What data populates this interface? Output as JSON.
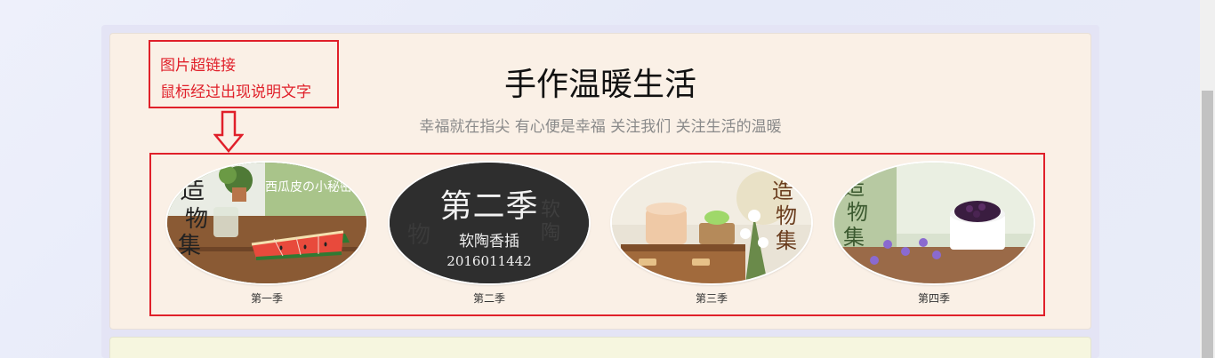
{
  "header": {
    "title": "手作温暖生活",
    "subtitle": "幸福就在指尖 有心便是幸福 关注我们 关注生活的温暖"
  },
  "annotation": {
    "line1": "图片超链接",
    "line2": "鼠标经过出现说明文字"
  },
  "gallery": [
    {
      "caption": "第一季",
      "image_text": "西瓜皮の小秘密"
    },
    {
      "caption": "第二季",
      "hover_title": "第二季",
      "hover_subtitle": "软陶香插",
      "hover_id": "2016011442"
    },
    {
      "caption": "第三季"
    },
    {
      "caption": "第四季"
    }
  ],
  "colors": {
    "accent_red": "#e0202a",
    "card_bg": "#faf0e6",
    "second_card_bg": "#f6f6df"
  }
}
